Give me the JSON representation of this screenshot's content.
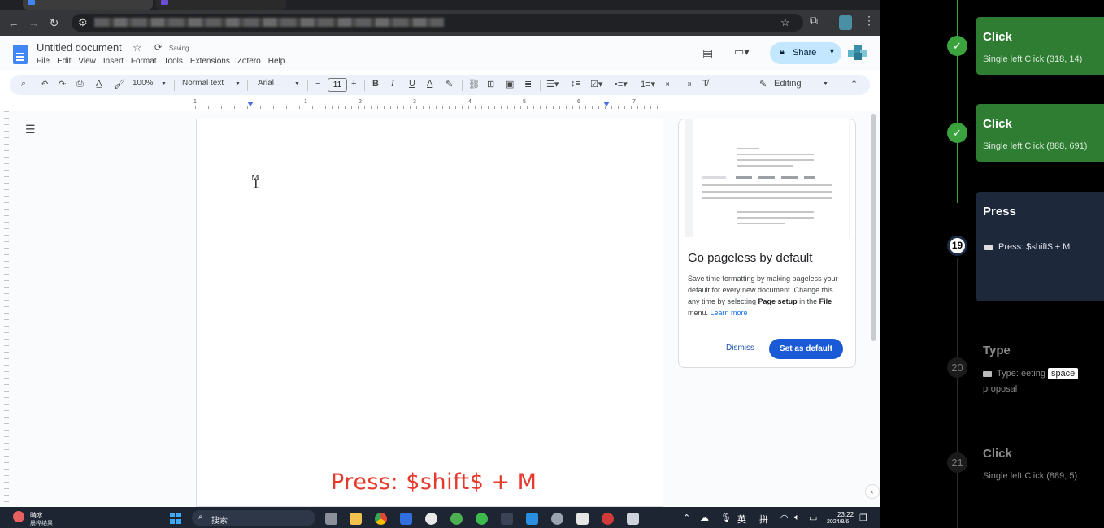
{
  "doc": {
    "title": "Untitled document",
    "status": "Saving...",
    "menu": [
      "File",
      "Edit",
      "View",
      "Insert",
      "Format",
      "Tools",
      "Extensions",
      "Zotero",
      "Help"
    ],
    "share_label": "Share",
    "typed_text": "M"
  },
  "format_bar": {
    "zoom": "100%",
    "style": "Normal text",
    "font": "Arial",
    "font_size": "11",
    "mode": "Editing"
  },
  "ruler": {
    "numbers": [
      "1",
      "1",
      "2",
      "3",
      "4",
      "5",
      "6",
      "7"
    ]
  },
  "pageless_card": {
    "title": "Go pageless by default",
    "body_1": "Save time formatting by making pageless your default for every new document. Change this any time by selecting ",
    "body_bold_1": "Page setup",
    "body_2": " in the ",
    "body_bold_2": "File",
    "body_3": " menu. ",
    "learn_more": "Learn more",
    "dismiss": "Dismiss",
    "set_default": "Set as default"
  },
  "key_overlay": "Press: $shift$ + M",
  "taskbar": {
    "weather_temp": "晴水",
    "weather_desc": "晨桦结果",
    "search_placeholder": "搜索",
    "ime_1": "英",
    "ime_2": "拼",
    "time": "23:22",
    "date": "2024/8/6"
  },
  "timeline": {
    "steps": [
      {
        "title": "Click",
        "detail": "Single left Click (318, 14)",
        "state": "done"
      },
      {
        "title": "Click",
        "detail": "Single left Click (888, 691)",
        "state": "done"
      },
      {
        "number": "19",
        "title": "Press",
        "detail": "Press: $shift$ + M",
        "state": "current"
      },
      {
        "number": "20",
        "title": "Type",
        "detail_pre": "Type: eeting",
        "detail_key": "space",
        "detail_post": "proposal",
        "state": "future"
      },
      {
        "number": "21",
        "title": "Click",
        "detail": "Single left Click (889, 5)",
        "state": "future"
      }
    ]
  },
  "colors": {
    "done": "#2f7d33",
    "current": "#1e283b",
    "share_bg": "#c2e7ff",
    "primary_button": "#1a5ad7",
    "overlay_text": "#e53a2d"
  }
}
